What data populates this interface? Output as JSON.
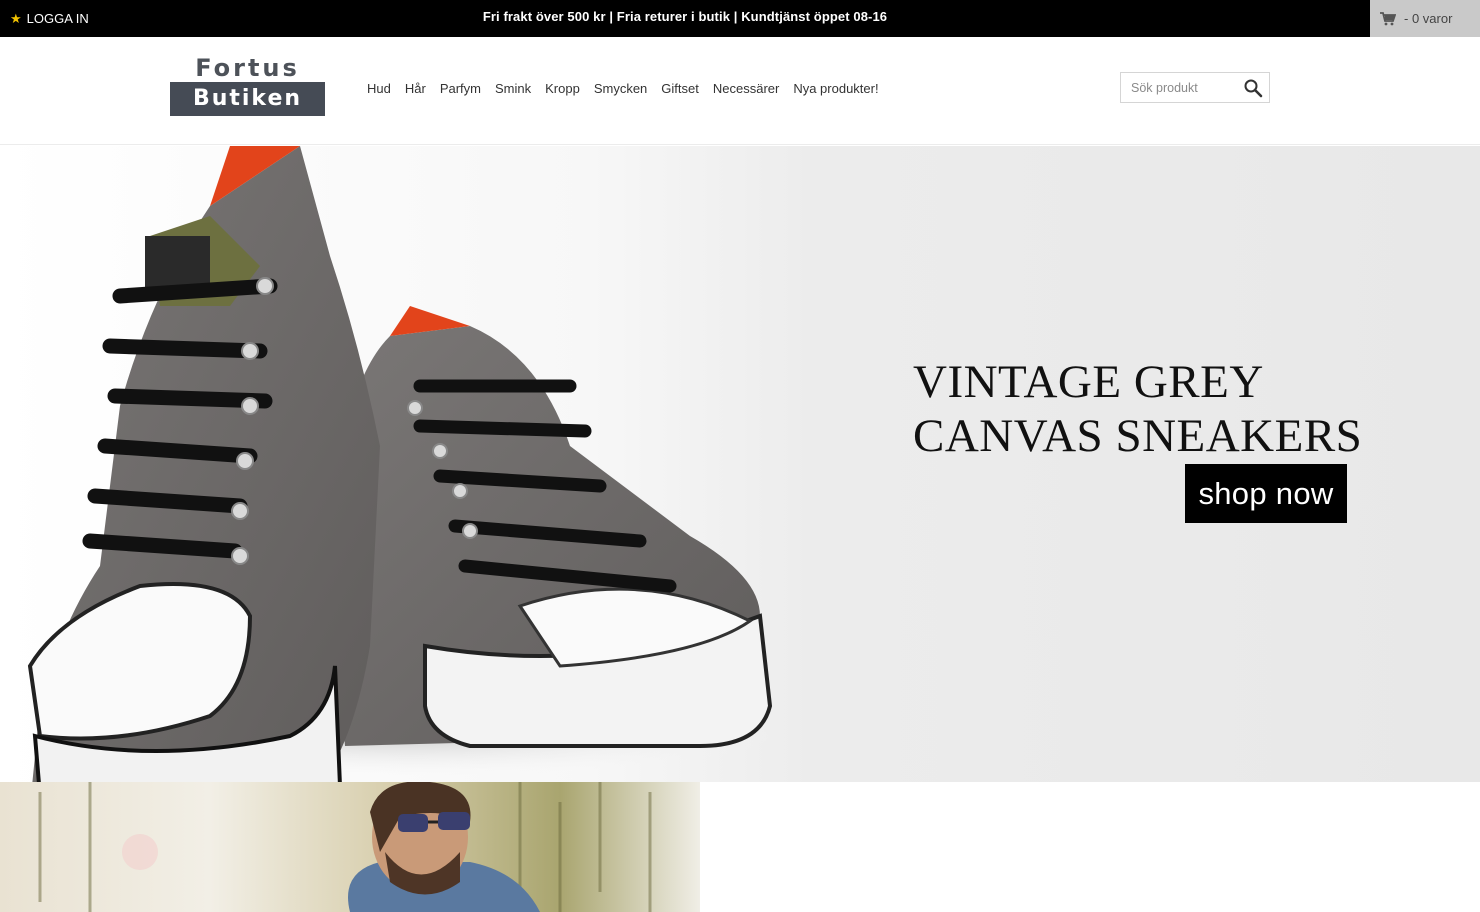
{
  "topbar": {
    "login_label": "LOGGA IN",
    "promo_text": "Fri frakt över 500 kr | Fria returer i butik | Kundtjänst öppet 08-16",
    "cart_label": "- 0 varor"
  },
  "logo": {
    "top": "Fortus",
    "bottom": "Butiken"
  },
  "nav": {
    "items": [
      "Hud",
      "Hår",
      "Parfym",
      "Smink",
      "Kropp",
      "Smycken",
      "Giftset",
      "Necessärer",
      "Nya produkter!"
    ]
  },
  "search": {
    "placeholder": "Sök produkt",
    "value": ""
  },
  "hero": {
    "title_line1": "VINTAGE GREY",
    "title_line2": "CANVAS SNEAKERS",
    "cta_label": "shop now",
    "image": "grey-canvas-sneakers-photo"
  },
  "banner2": {
    "image": "man-with-sunglasses-photo"
  },
  "colors": {
    "topbar_bg": "#000000",
    "cart_bg": "#c9c9c9",
    "star": "#f2c200",
    "logo_dark": "#454b55",
    "cta_bg": "#000000"
  },
  "icons": {
    "login": "star-icon",
    "cart": "cart-icon",
    "search": "magnifier-icon"
  }
}
